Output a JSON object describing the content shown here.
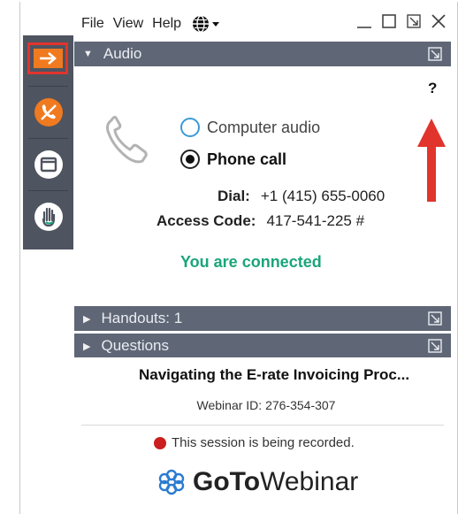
{
  "menu": {
    "file": "File",
    "view": "View",
    "help": "Help"
  },
  "toolbar": {
    "items": [
      {
        "icon": "arrow-right-icon",
        "color": "#f07a1f"
      },
      {
        "icon": "mute-phone-icon",
        "color": "#f07a1f"
      },
      {
        "icon": "window-icon",
        "color": "#ffffff"
      },
      {
        "icon": "raise-hand-icon",
        "color": "#ffffff"
      }
    ]
  },
  "panels": {
    "audio": {
      "title": "Audio"
    },
    "handouts": {
      "title": "Handouts: 1"
    },
    "questions": {
      "title": "Questions"
    }
  },
  "audio": {
    "help": "?",
    "option_computer": "Computer audio",
    "option_phone": "Phone call",
    "dial_label": "Dial:",
    "dial_value": "+1 (415) 655-0060",
    "access_label": "Access Code:",
    "access_value": "417-541-225 #",
    "status": "You are connected"
  },
  "webinar": {
    "title": "Navigating the E-rate Invoicing Proc...",
    "id_text": "Webinar ID: 276-354-307",
    "recording_text": "This session is being recorded."
  },
  "brand": {
    "goto": "GoTo",
    "webinar": "Webinar"
  },
  "colors": {
    "accent_orange": "#f07a1f",
    "annotation_red": "#e1342d",
    "connected_green": "#1aa57a",
    "header_gray": "#5f6776",
    "toolbar_gray": "#4e5460"
  }
}
